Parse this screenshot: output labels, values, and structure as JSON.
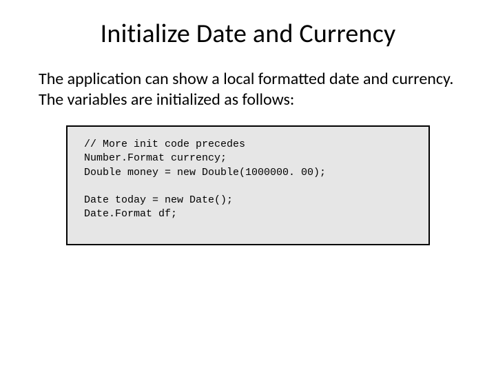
{
  "title": "Initialize Date and Currency",
  "body": "The application can show a local formatted date and currency. The variables are initialized as follows:",
  "code": "// More init code precedes\nNumber.Format currency;\nDouble money = new Double(1000000. 00);\n\nDate today = new Date();\nDate.Format df;"
}
